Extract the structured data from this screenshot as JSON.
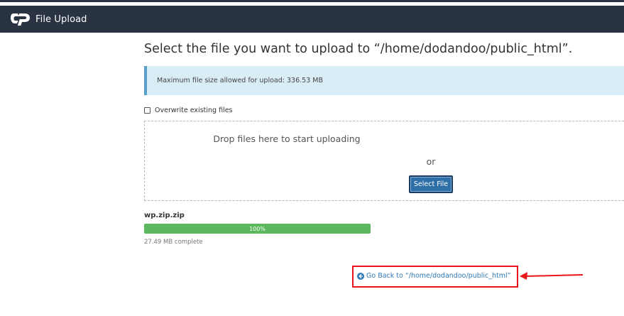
{
  "app": {
    "title": "File Upload",
    "logo_icon": "cpanel-logo-icon"
  },
  "page": {
    "heading": "Select the file you want to upload to “/home/dodandoo/public_html”."
  },
  "alert": {
    "text": "Maximum file size allowed for upload: 336.53 MB"
  },
  "options": {
    "overwrite_label": "Overwrite existing files",
    "overwrite_checked": false
  },
  "dropzone": {
    "drop_text": "Drop files here to start uploading",
    "or_text": "or",
    "select_button": "Select File"
  },
  "upload": {
    "filename": "wp.zip.zip",
    "progress_label": "100%",
    "progress_fraction": 1.0,
    "status": "27.49 MB complete"
  },
  "navigation": {
    "go_back_label": "Go Back to “/home/dodandoo/public_html”",
    "go_back_icon": "arrow-circle-left-icon"
  },
  "colors": {
    "header_bg": "#2a3342",
    "alert_bg": "#d9edf7",
    "progress": "#5cb85c",
    "button": "#2e6fa7",
    "link": "#2f7ab8",
    "annotation": "#e8161b"
  }
}
